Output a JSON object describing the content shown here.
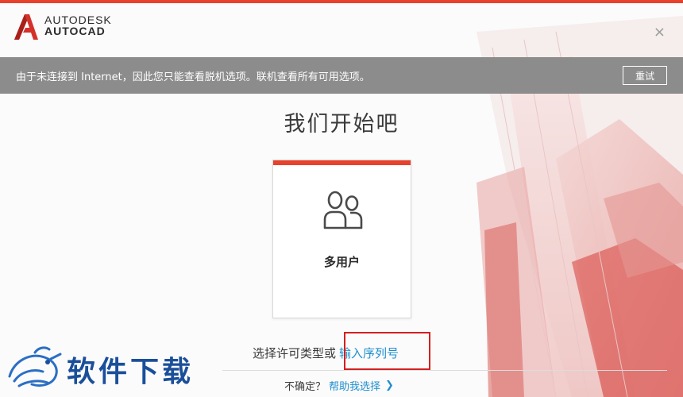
{
  "header": {
    "brand_line1": "AUTODESK",
    "brand_line2": "AUTOCAD",
    "close_symbol": "×"
  },
  "offline_bar": {
    "message": "由于未连接到 Internet，因此您只能查看脱机选项。联机查看所有可用选项。",
    "retry_label": "重试"
  },
  "main": {
    "title": "我们开始吧",
    "card": {
      "label": "多用户",
      "icon": "multi-user-icon"
    },
    "license_prompt": "选择许可类型或",
    "serial_link": "输入序列号",
    "help_prompt": "不确定？",
    "help_link": "帮助我选择",
    "help_chevron": "❯"
  },
  "watermark": {
    "text": "软件下载",
    "icon": "dragon-logo-icon"
  },
  "colors": {
    "accent": "#e8412c",
    "offline_bar": "#8c8c8c",
    "link": "#1f8fce",
    "highlight": "#d42020",
    "watermark": "#1a4f9a"
  }
}
